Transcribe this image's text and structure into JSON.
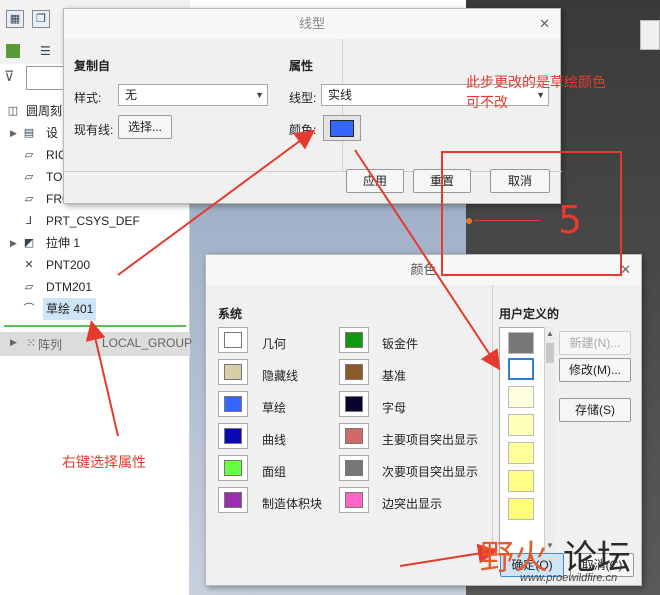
{
  "model_tree": {
    "items": [
      {
        "label": "圆周刻",
        "icon": "part-icon"
      },
      {
        "label": "设",
        "icon": "layer-icon"
      },
      {
        "label": "RIG",
        "icon": "datum-plane-icon"
      },
      {
        "label": "TO",
        "icon": "datum-plane-icon"
      },
      {
        "label": "FRO",
        "icon": "datum-plane-icon"
      },
      {
        "label": "PRT_CSYS_DEF",
        "icon": "csys-icon"
      },
      {
        "label": "拉伸 1",
        "icon": "extrude-icon"
      },
      {
        "label": "PNT200",
        "icon": "datum-point-icon"
      },
      {
        "label": "DTM201",
        "icon": "datum-plane-icon"
      },
      {
        "label": "草绘 401",
        "icon": "sketch-icon"
      }
    ],
    "bottom_item": {
      "prefix": "阵列",
      "suffix": "LOCAL_GROUP"
    }
  },
  "line_dialog": {
    "title": "线型",
    "copy_from_label": "复制自",
    "style_label": "样式:",
    "style_value": "无",
    "existing_line_label": "现有线:",
    "select_button": "选择...",
    "properties_label": "属性",
    "line_type_label": "线型:",
    "line_type_value": "实线",
    "color_label": "颜色:",
    "swatch_color": "#3566ff",
    "apply_button": "应用",
    "reset_button": "重置",
    "cancel_button": "取消"
  },
  "color_dialog": {
    "title": "颜色",
    "system_label": "系统",
    "system_colors": [
      {
        "label": "几何",
        "color": "#ffffff"
      },
      {
        "label": "隐藏线",
        "color": "#d8cfa8"
      },
      {
        "label": "草绘",
        "color": "#3566ff"
      },
      {
        "label": "曲线",
        "color": "#0a0ab4"
      },
      {
        "label": "面组",
        "color": "#66ff44"
      },
      {
        "label": "制造体积块",
        "color": "#9a30b0"
      },
      {
        "label": "钣金件",
        "color": "#119911"
      },
      {
        "label": "基准",
        "color": "#8a5a2a"
      },
      {
        "label": "字母",
        "color": "#05052e"
      },
      {
        "label": "主要项目突出显示",
        "color": "#d06a6a"
      },
      {
        "label": "次要项目突出显示",
        "color": "#767676"
      },
      {
        "label": "边突出显示",
        "color": "#ff66cc"
      }
    ],
    "user_defined_label": "用户定义的",
    "user_colors": [
      "#777777",
      "#ffffff",
      "#ffffdd",
      "#ffffbb",
      "#ffff99",
      "#ffff88",
      "#ffff77"
    ],
    "new_button": "新建(N)...",
    "modify_button": "修改(M)...",
    "save_button": "存储(S)",
    "ok_button": "确定(O)",
    "cancel_button": "取消(C)"
  },
  "annotations": {
    "note_top": "此步更改的是草绘颜色",
    "note_top2": "可不改",
    "note_left": "右键选择属性",
    "number": "5",
    "annotation_color": "#e53a2e"
  },
  "watermark": {
    "cn_part1": "野火",
    "cn_part2": "论坛",
    "url": "www.proewildfire.cn"
  }
}
